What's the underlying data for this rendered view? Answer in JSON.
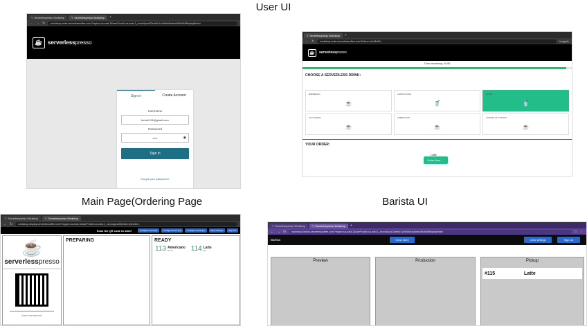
{
  "captions": {
    "user_ui": "User UI",
    "main_page": "Main Page(Ordering Page",
    "barista_ui": "Barista UI"
  },
  "user_ui": {
    "browser": {
      "tabs": [
        "Serverlesspresso Workshop",
        "Serverlesspresso Workshop"
      ],
      "url": "workshop-order.serverlesscoffee.com/?region=us-east-1&userPoolId=us-east-1_xxxxx&poolClientId=1nr5d5cf4sabwb2bk0fd4f8lnpbq8lmkm"
    },
    "logo": {
      "bold": "serverless",
      "light": "presso"
    },
    "login": {
      "tab_signin": "Sign in",
      "tab_create": "Create Account",
      "username_label": "Username",
      "username_value": "behw0.34@gmail.com",
      "password_label": "Password",
      "password_value": "•••••",
      "signin_button": "Sign in",
      "forgot": "Forgot your password?"
    }
  },
  "order_ui": {
    "browser": {
      "tabs": [
        "Serverlesspresso Workshop"
      ],
      "url": "workshop-order.serverlesscoffee.com/?token=c4c48e05c",
      "profile": "Incognito"
    },
    "logo": {
      "bold": "serverless",
      "light": "presso"
    },
    "timer": "Time remaining:",
    "timer_value": "04:55",
    "progress": 0.98,
    "choose_title": "CHOOSE A SERVERLESS DRINK:",
    "drinks": [
      {
        "name": "ESPRESSO",
        "icon": "espresso-cup-icon",
        "glyph": "☕",
        "selected": false
      },
      {
        "name": "CAPPUCCINO",
        "icon": "cappuccino-icon",
        "glyph": "🥤",
        "selected": false
      },
      {
        "name": "LATTE",
        "icon": "latte-icon",
        "glyph": "🥤",
        "selected": true
      },
      {
        "name": "FLAT WHITE",
        "icon": "flat-white-icon",
        "glyph": "☕",
        "selected": false
      },
      {
        "name": "AMERICANO",
        "icon": "americano-icon",
        "glyph": "☕",
        "selected": false
      },
      {
        "name": "COFFEE OF THE DAY",
        "icon": "coffee-of-day-icon",
        "glyph": "☕",
        "selected": false
      }
    ],
    "your_order": "YOUR ORDER:",
    "order_item": "Latte",
    "order_button": "Order Now"
  },
  "display_ui": {
    "browser": {
      "tabs": [
        "Serverlesspresso Workshop",
        "Serverlesspresso Workshop"
      ],
      "url": "workshop-display.serverlesscoffee.com/?region=us-east-1&userPoolId=us-east-1_xxxxx&poolClientId=1mrw4kh..."
    },
    "scan_text": "Scan the QR code to start!",
    "top_buttons": [
      "Configure event app",
      "Configure event app",
      "Configure event app",
      "Store settings",
      "Sign out"
    ],
    "logo": {
      "bold": "serverless",
      "light": "presso"
    },
    "preparing": "PREPARING",
    "ready": "READY",
    "ready_orders": [
      {
        "number": "113",
        "drink": "Americano",
        "sub": "Bar Ma"
      },
      {
        "number": "114",
        "drink": "Latte",
        "sub": "Rhe"
      }
    ],
    "qr_caption": "EVENT APP PREVIEW"
  },
  "barista_ui": {
    "browser": {
      "tabs": [
        "Serverlesspresso Workshop",
        "Serverlesspresso Workshop"
      ],
      "url": "workshop-barista.serverlesscoffee.com/?region=us-east-1&userPoolId=us-east-1_xxxxx&poolClientId=1nr5d5cf4sabwb2bk0fd4f8lnpbq8lmkm"
    },
    "app_name": "Barista",
    "close_store": "Close store",
    "clear_settings": "Clear settings",
    "sign_out": "Sign out",
    "columns": [
      "Preview",
      "Production",
      "Pickup"
    ],
    "pickup": [
      {
        "number": "#115",
        "drink": "Latte"
      }
    ]
  }
}
